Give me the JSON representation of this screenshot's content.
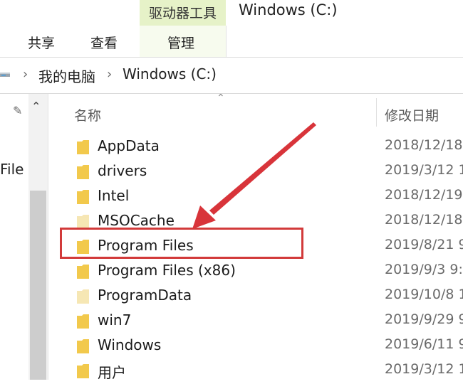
{
  "ribbon": {
    "context_tab": "驱动器工具",
    "window_title": "Windows (C:)",
    "tabs": [
      "共享",
      "查看",
      "管理"
    ]
  },
  "address": {
    "crumbs": [
      "我的电脑",
      "Windows (C:)"
    ]
  },
  "nav": {
    "partial_label": "File"
  },
  "columns": {
    "name": "名称",
    "date": "修改日期"
  },
  "files": [
    {
      "name": "AppData",
      "date": "2018/12/18",
      "faded": false
    },
    {
      "name": "drivers",
      "date": "2019/3/12 1",
      "faded": false
    },
    {
      "name": "Intel",
      "date": "2018/12/19",
      "faded": false
    },
    {
      "name": "MSOCache",
      "date": "2018/12/18",
      "faded": true
    },
    {
      "name": "Program Files",
      "date": "2019/8/21 9",
      "faded": false
    },
    {
      "name": "Program Files (x86)",
      "date": "2019/9/3 9:",
      "faded": false
    },
    {
      "name": "ProgramData",
      "date": "2019/10/8 1",
      "faded": true
    },
    {
      "name": "win7",
      "date": "2019/9/29 9",
      "faded": false
    },
    {
      "name": "Windows",
      "date": "2019/6/11 9",
      "faded": false
    },
    {
      "name": "用户",
      "date": "2019/3/12 1",
      "faded": false
    }
  ],
  "annotation": {
    "highlighted_item": "Program Files",
    "color": "#d23a3a"
  },
  "colors": {
    "folder": "#f2c94c",
    "folder_faded": "#f6e6b4",
    "context_tab": "#e6f2c8"
  }
}
